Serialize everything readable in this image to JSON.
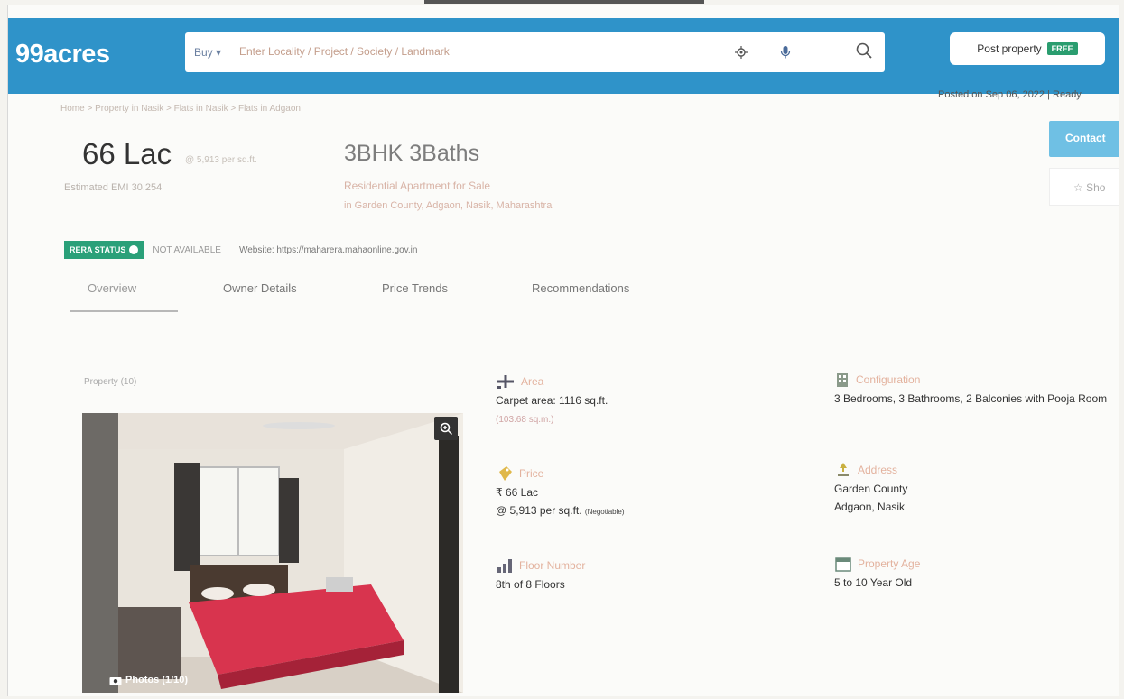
{
  "header": {
    "logo": "99acres",
    "search": {
      "buy_label": "Buy",
      "placeholder": "Enter Locality / Project / Society / Landmark"
    },
    "post_property": {
      "label": "Post property",
      "badge": "FREE"
    }
  },
  "meta": {
    "posted": "Posted on Sep 06, 2022 | Ready",
    "breadcrumb": "Home > Property in Nasik > Flats in Nasik > Flats in Adgaon"
  },
  "listing": {
    "price": "66 Lac",
    "price_per_sqft": "@ 5,913 per sq.ft.",
    "emi": "Estimated EMI 30,254",
    "title": "3BHK 3Baths",
    "subtitle": "Residential Apartment for Sale",
    "location": "in Garden County, Adgaon, Nasik, Maharashtra",
    "contact_label": "Contact",
    "shortlist_label": "Sho"
  },
  "rera": {
    "badge": "RERA STATUS",
    "status": "NOT AVAILABLE",
    "website": "Website: https://maharera.mahaonline.gov.in"
  },
  "tabs": [
    "Overview",
    "Owner Details",
    "Price Trends",
    "Recommendations"
  ],
  "gallery": {
    "label": "Property (10)",
    "badge": "Photos (1/10)"
  },
  "features": {
    "area": {
      "label": "Area",
      "line1": "Carpet area: 1116  sq.ft.",
      "line2": "(103.68 sq.m.)"
    },
    "configuration": {
      "label": "Configuration",
      "line1": "3 Bedrooms, 3 Bathrooms, 2 Balconies with Pooja Room"
    },
    "price": {
      "label": "Price",
      "line1": "₹ 66 Lac",
      "line2": "@ 5,913 per sq.ft.",
      "negotiable": "(Negotiable)"
    },
    "address": {
      "label": "Address",
      "line1": "Garden County",
      "line2": "Adgaon, Nasik"
    },
    "floor": {
      "label": "Floor Number",
      "line1": "8th of 8 Floors"
    },
    "age": {
      "label": "Property Age",
      "line1": "5 to 10 Year Old"
    }
  },
  "colors": {
    "header_bg": "#2f93c9",
    "rera_green": "#2aa079",
    "accent_label": "#e3b29e"
  }
}
